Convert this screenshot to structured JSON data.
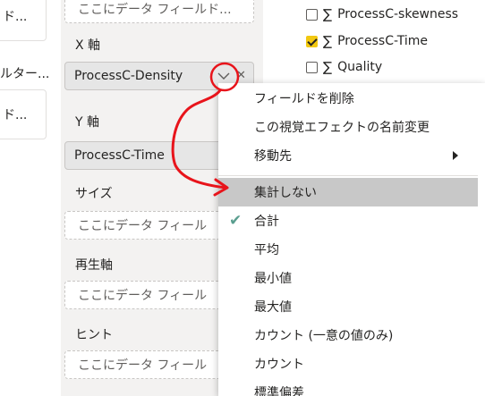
{
  "left_panel": {
    "card1_text": "ド...",
    "filter_text": "ルター...",
    "card2_text": "ド..."
  },
  "wells": {
    "top_placeholder": "ここにデータ フィールド...",
    "x_axis_label": "X 軸",
    "x_axis_value": "ProcessC-Density",
    "y_axis_label": "Y 軸",
    "y_axis_value": "ProcessC-Time",
    "size_label": "サイズ",
    "size_placeholder": "ここにデータ フィール",
    "play_axis_label": "再生軸",
    "play_axis_placeholder": "ここにデータ フィール",
    "tooltip_label": "ヒント",
    "tooltip_placeholder": "ここにデータ フィール",
    "remove_glyph": "✕"
  },
  "fields": {
    "items": [
      {
        "label": "ProcessC-skewness",
        "checked": false
      },
      {
        "label": "ProcessC-Time",
        "checked": true
      },
      {
        "label": "Quality",
        "checked": false
      }
    ],
    "sigma": "∑"
  },
  "context_menu": {
    "remove_field": "フィールドを削除",
    "rename": "この視覚エフェクトの名前変更",
    "move_to": "移動先",
    "dont_summarize": "集計しない",
    "sum": "合計",
    "average": "平均",
    "minimum": "最小値",
    "maximum": "最大値",
    "count_distinct": "カウント (一意の値のみ)",
    "count": "カウント",
    "std_dev": "標準偏差",
    "check_glyph": "✔"
  },
  "colors": {
    "annotation_red": "#e8141b",
    "accent_yellow": "#f2c811",
    "hover_gray": "#c8c8c8",
    "checkmark_teal": "#5a9e8f"
  }
}
